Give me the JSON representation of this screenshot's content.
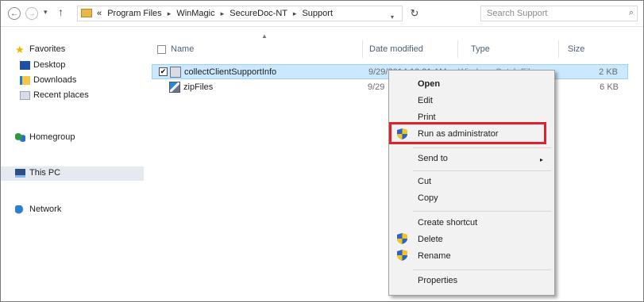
{
  "address_bar": {
    "back_label": "←",
    "forward_label": "→",
    "dropdown_label": "▾",
    "up_label": "↑",
    "overflow": "«",
    "crumbs": [
      "Program Files",
      "WinMagic",
      "SecureDoc-NT",
      "Support"
    ],
    "crumb_separator": "▸",
    "refresh_label": "↻",
    "search_placeholder": "Search Support",
    "search_icon": "⌕"
  },
  "nav_pane": {
    "favorites": "Favorites",
    "desktop": "Desktop",
    "downloads": "Downloads",
    "recent_places": "Recent places",
    "homegroup": "Homegroup",
    "this_pc": "This PC",
    "network": "Network"
  },
  "columns": {
    "name": "Name",
    "date_modified": "Date modified",
    "type": "Type",
    "size": "Size"
  },
  "files": [
    {
      "name": "collectClientSupportInfo",
      "date": "9/29/2014 10:31 AM",
      "type": "Windows Batch File",
      "size": "2 KB",
      "selected": true,
      "checkbox": "✔"
    },
    {
      "name": "zipFiles",
      "date": "9/29",
      "type": "",
      "size": "6 KB",
      "selected": false
    }
  ],
  "context_menu": {
    "open": "Open",
    "edit": "Edit",
    "print": "Print",
    "run_as_admin": "Run as administrator",
    "send_to": "Send to",
    "send_to_arrow": "▸",
    "cut": "Cut",
    "copy": "Copy",
    "create_shortcut": "Create shortcut",
    "delete": "Delete",
    "rename": "Rename",
    "properties": "Properties"
  },
  "colors": {
    "highlight_box": "#e0202a",
    "selection_bg": "#cce8ff",
    "shield_blue": "#2a63c9",
    "shield_yellow": "#f5c518"
  },
  "icons": {
    "favorites": "star-icon",
    "desktop": "desktop-icon",
    "downloads": "downloads-icon",
    "recent": "recent-places-icon",
    "homegroup": "homegroup-icon",
    "this_pc": "computer-icon",
    "network": "network-icon",
    "shield": "uac-shield-icon"
  }
}
